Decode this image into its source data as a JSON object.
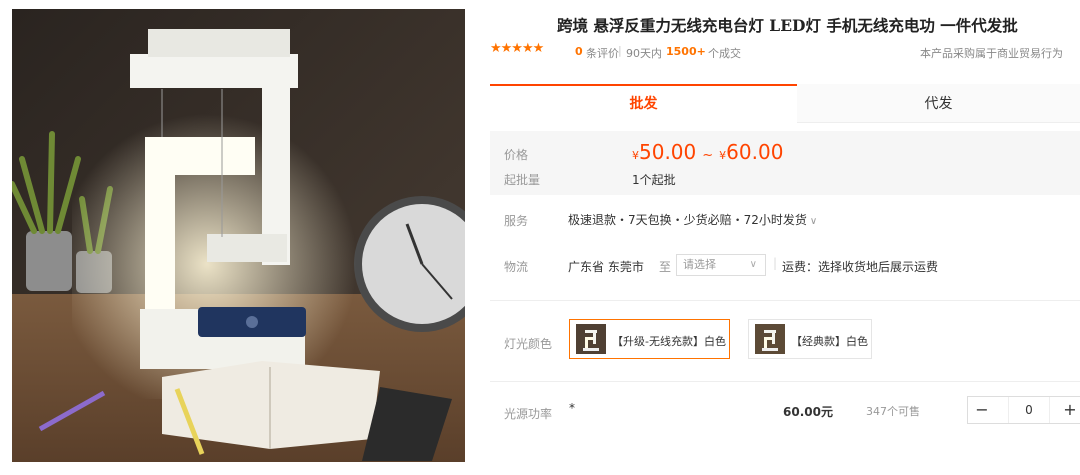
{
  "product": {
    "title": "跨境 悬浮反重力无线充电台灯 LED灯 手机无线充电功 一件代发批",
    "image_alt": "悬浮反重力无线充电台灯"
  },
  "rating": {
    "stars": "★★★★★",
    "review_count": "0",
    "review_label": "条评价",
    "days_label": "90天内",
    "deals_count": "1500+",
    "deals_unit": "个成交",
    "trade_note": "本产品采购属于商业贸易行为"
  },
  "tabs": [
    {
      "label": "批发",
      "active": true
    },
    {
      "label": "代发",
      "active": false
    }
  ],
  "price": {
    "label": "价格",
    "currency": "¥",
    "min": "50.00",
    "tilde": "~",
    "max": "60.00",
    "moq_label": "起批量",
    "moq_value": "1个起批"
  },
  "service": {
    "label": "服务",
    "value": "极速退款・7天包换・少货必赔・72小时发货"
  },
  "logistics": {
    "label": "物流",
    "origin": "广东省 东莞市",
    "to": "至",
    "select_placeholder": "请选择",
    "freight": "运费：选择收货地后展示运费"
  },
  "color": {
    "label": "灯光颜色",
    "options": [
      {
        "label": "【升级-无线充款】白色",
        "selected": true
      },
      {
        "label": "【经典款】白色",
        "selected": false
      }
    ]
  },
  "sku": {
    "label": "光源功率",
    "value": "*",
    "price": "60.00元",
    "stock": "347个可售",
    "minus": "−",
    "qty": "0",
    "plus": "+"
  },
  "colors": {
    "accent": "#ff4400",
    "star": "#ff7300",
    "price_bg": "#f6f6f6"
  }
}
